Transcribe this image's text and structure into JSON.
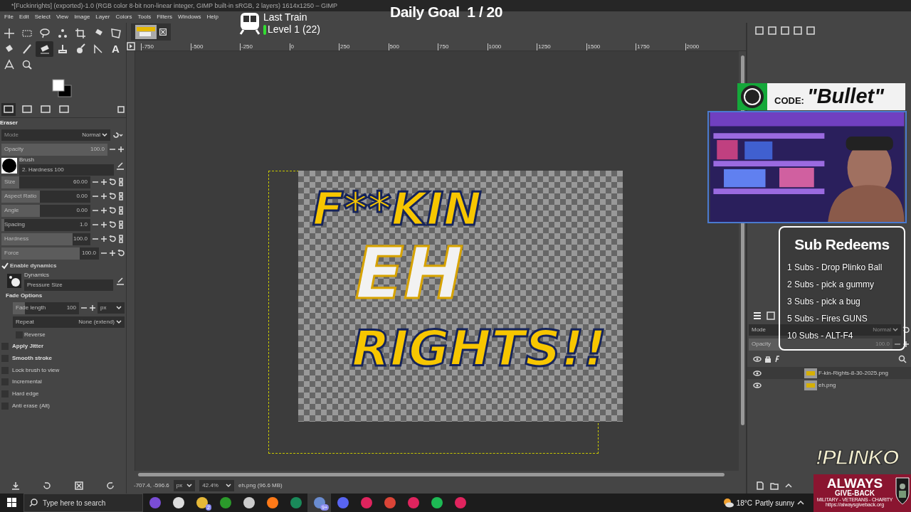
{
  "window": {
    "title": "*[Fuckinrights] (exported)-1.0 (RGB color 8-bit non-linear integer, GIMP built-in sRGB, 2 layers) 1614x1250 – GIMP"
  },
  "menu": [
    "File",
    "Edit",
    "Select",
    "View",
    "Image",
    "Layer",
    "Colors",
    "Tools",
    "Filters",
    "Windows",
    "Help"
  ],
  "tools": [
    {
      "selected": false
    },
    {
      "selected": false
    },
    {
      "selected": false
    },
    {
      "selected": false
    },
    {
      "selected": false
    },
    {
      "selected": false
    },
    {
      "selected": false
    },
    {
      "selected": false
    },
    {
      "selected": false
    },
    {
      "selected": true
    },
    {
      "selected": false
    },
    {
      "selected": false
    },
    {
      "selected": false
    },
    {
      "kind": "glyph",
      "glyph": "A",
      "selected": false
    },
    {
      "selected": false
    },
    {
      "selected": false
    }
  ],
  "ruler": [
    "-750",
    "-500",
    "-250",
    "0",
    "250",
    "500",
    "750",
    "1000",
    "1250",
    "1500",
    "1750",
    "2000"
  ],
  "tool_options": {
    "title": "Eraser",
    "mode": {
      "label": "Mode",
      "value": "Normal"
    },
    "opacity": {
      "label": "Opacity",
      "value": "100.0",
      "level": 1.0
    },
    "brush": {
      "label": "Brush",
      "value": "2. Hardness 100"
    },
    "sliders": [
      {
        "label": "Size",
        "value": "60.00",
        "level": 0.2
      },
      {
        "label": "Aspect Ratio",
        "value": "0.00",
        "level": 0.43
      },
      {
        "label": "Angle",
        "value": "0.00",
        "level": 0.43
      },
      {
        "label": "Spacing",
        "value": "1.0",
        "level": 0.03
      },
      {
        "label": "Hardness",
        "value": "100.0",
        "level": 0.8
      },
      {
        "label": "Force",
        "value": "100.0",
        "level": 0.8
      }
    ],
    "enable_dynamics": {
      "label": "Enable dynamics",
      "checked": true
    },
    "dynamics": {
      "label": "Dynamics",
      "value": "Pressure Size"
    },
    "fade": {
      "heading": "Fade Options",
      "length": {
        "label": "Fade length",
        "value": "100",
        "level": 0.18
      },
      "unit": "px",
      "repeat": {
        "label": "Repeat",
        "value": "None (extend)"
      },
      "reverse": {
        "label": "Reverse",
        "checked": false
      }
    },
    "options": [
      {
        "label": "Apply Jitter",
        "checked": false,
        "kind": "expander"
      },
      {
        "label": "Smooth stroke",
        "checked": false,
        "kind": "expander"
      },
      {
        "label": "Lock brush to view",
        "checked": false,
        "kind": "plain"
      },
      {
        "label": "Incremental",
        "checked": false,
        "kind": "plain"
      },
      {
        "label": "Hard edge",
        "checked": false,
        "kind": "plain"
      },
      {
        "label": "Anti erase  (Alt)",
        "checked": false,
        "kind": "plain"
      }
    ]
  },
  "artwork": {
    "lines": [
      "F**KIN",
      "EH",
      "RIGHTS!!"
    ]
  },
  "status_bar": {
    "coords": "-707.4, -596.6",
    "unit": "px",
    "zoom": "42.4%",
    "info": "eh.png (96.6 MB)"
  },
  "layers_panel": {
    "mode": {
      "label": "Mode",
      "value": "Normal"
    },
    "opacity": {
      "label": "Opacity",
      "value": "100.0",
      "level": 1.0
    },
    "layers": [
      {
        "name": "F-kin-Rights-8-30-2025.png",
        "visible": true
      },
      {
        "name": "eh.png",
        "visible": true
      }
    ]
  },
  "overlays": {
    "train": {
      "title": "Last Train",
      "level": "Level 1  (22)"
    },
    "daily_goal": "Daily Goal  1 / 20",
    "code": {
      "label": "CODE:",
      "value": "\"Bullet\""
    },
    "sub_redeems": {
      "title": "Sub Redeems",
      "items": [
        "1 Subs - Drop Plinko Ball",
        "2 Subs - pick a gummy",
        "3 Subs - pick a bug",
        "5 Subs - Fires GUNS",
        "10 Subs - ALT-F4"
      ]
    },
    "plinko": "!PLINKO",
    "charity": {
      "line1": "ALWAYS",
      "line2": "GIVE-BACK",
      "line3": "MILITARY - VETERANS - CHARITY",
      "url": "https://alwaysgiveback.org"
    }
  },
  "taskbar": {
    "search": {
      "placeholder": "Type here to search"
    },
    "apps": [
      {
        "selected": false
      },
      {
        "selected": false
      },
      {
        "badge": "2",
        "selected": false
      },
      {
        "selected": false
      },
      {
        "selected": false
      },
      {
        "selected": false
      },
      {
        "selected": false
      },
      {
        "badge": "9+",
        "selected": true
      },
      {
        "selected": false
      },
      {
        "selected": false
      },
      {
        "selected": false
      },
      {
        "selected": false
      },
      {
        "selected": false
      },
      {
        "selected": false
      }
    ],
    "weather": {
      "temp": "18°C",
      "text": "Partly sunny"
    }
  }
}
